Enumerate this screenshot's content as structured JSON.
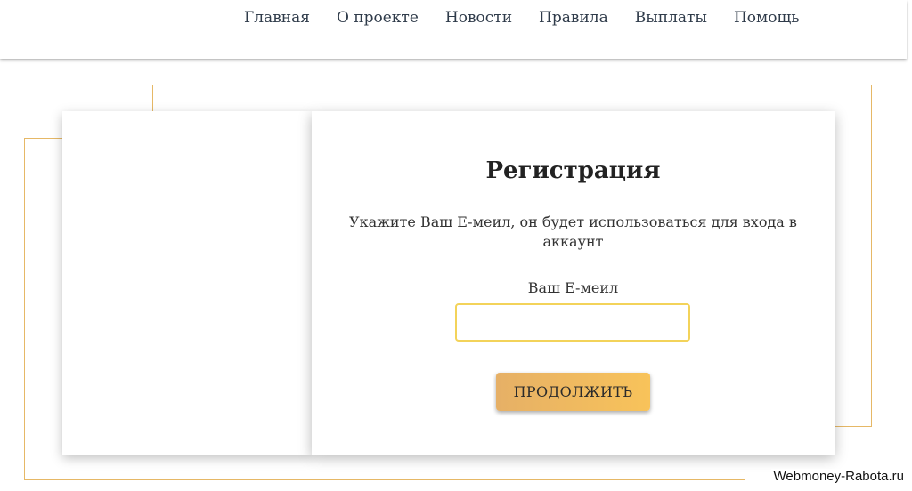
{
  "nav": {
    "items": [
      {
        "label": "Главная"
      },
      {
        "label": "О проекте"
      },
      {
        "label": "Новости"
      },
      {
        "label": "Правила"
      },
      {
        "label": "Выплаты"
      },
      {
        "label": "Помощь"
      }
    ]
  },
  "form": {
    "title": "Регистрация",
    "description": "Укажите Ваш E-меил, он будет использоваться для входа в аккаунт",
    "email_label": "Ваш E-меил",
    "email_value": "",
    "email_placeholder": "",
    "submit_label": "ПРОДОЛЖИТЬ"
  },
  "watermark": {
    "text": "Webmoney-Rabota.ru"
  },
  "colors": {
    "accent_border": "#e6b866",
    "input_border": "#f3d35a",
    "button_gradient_start": "#e6b066",
    "button_gradient_end": "#f8c35a",
    "nav_text": "#2f3b4a"
  }
}
